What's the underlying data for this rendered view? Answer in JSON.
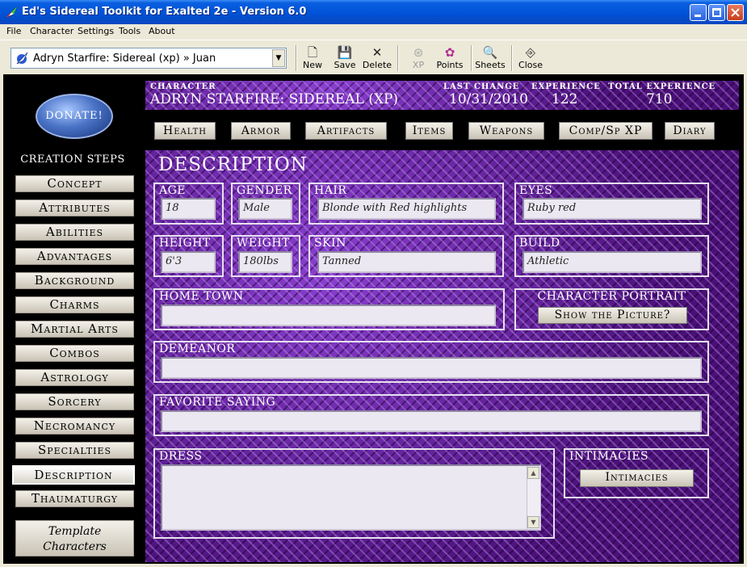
{
  "window": {
    "title": "Ed's Sidereal Toolkit for Exalted 2e - Version 6.0"
  },
  "menu": [
    "File",
    "Character",
    "Settings",
    "Tools",
    "About"
  ],
  "toolbar": {
    "character_select": "Adryn Starfire: Sidereal (xp) » Juan",
    "tools": [
      {
        "label": "New",
        "icon": "new-page-icon"
      },
      {
        "label": "Save",
        "icon": "floppy-icon"
      },
      {
        "label": "Delete",
        "icon": "delete-x-icon"
      },
      {
        "label": "XP",
        "icon": "xp-icon",
        "disabled": true
      },
      {
        "label": "Points",
        "icon": "points-icon"
      },
      {
        "label": "Sheets",
        "icon": "sheets-icon"
      },
      {
        "label": "Close",
        "icon": "close-door-icon"
      }
    ]
  },
  "sidebar": {
    "donate": "DONATE!",
    "creation_title": "CREATION STEPS",
    "steps": [
      "Concept",
      "Attributes",
      "Abilities",
      "Advantages",
      "Background",
      "Charms",
      "Martial Arts",
      "Combos",
      "Astrology",
      "Sorcery",
      "Necromancy",
      "Specialties",
      "Description",
      "Thaumaturgy"
    ],
    "active_step": "Description",
    "template_line1": "Template",
    "template_line2": "Characters"
  },
  "header": {
    "character_label": "CHARACTER",
    "character_value": "ADRYN STARFIRE: SIDEREAL (XP)",
    "last_change_label": "LAST CHANGE",
    "last_change_value": "10/31/2010",
    "experience_label": "EXPERIENCE",
    "experience_value": "122",
    "total_experience_label": "TOTAL EXPERIENCE",
    "total_experience_value": "710"
  },
  "tabs": [
    "Health",
    "Armor",
    "Artifacts",
    "Items",
    "Weapons",
    "Comp/Sp XP",
    "Diary"
  ],
  "description": {
    "title": "DESCRIPTION",
    "age_label": "AGE",
    "age_value": "18",
    "gender_label": "GENDER",
    "gender_value": "Male",
    "hair_label": "HAIR",
    "hair_value": "Blonde with Red highlights",
    "eyes_label": "EYES",
    "eyes_value": "Ruby red",
    "height_label": "HEIGHT",
    "height_value": "6'3",
    "weight_label": "WEIGHT",
    "weight_value": "180lbs",
    "skin_label": "SKIN",
    "skin_value": "Tanned",
    "build_label": "BUILD",
    "build_value": "Athletic",
    "hometown_label": "HOME TOWN",
    "hometown_value": "",
    "portrait_label": "CHARACTER PORTRAIT",
    "portrait_button": "Show the Picture?",
    "demeanor_label": "DEMEANOR",
    "demeanor_value": "",
    "saying_label": "FAVORITE SAYING",
    "saying_value": "",
    "dress_label": "DRESS",
    "dress_value": "",
    "intimacies_label": "INTIMACIES",
    "intimacies_button": "Intimacies"
  }
}
